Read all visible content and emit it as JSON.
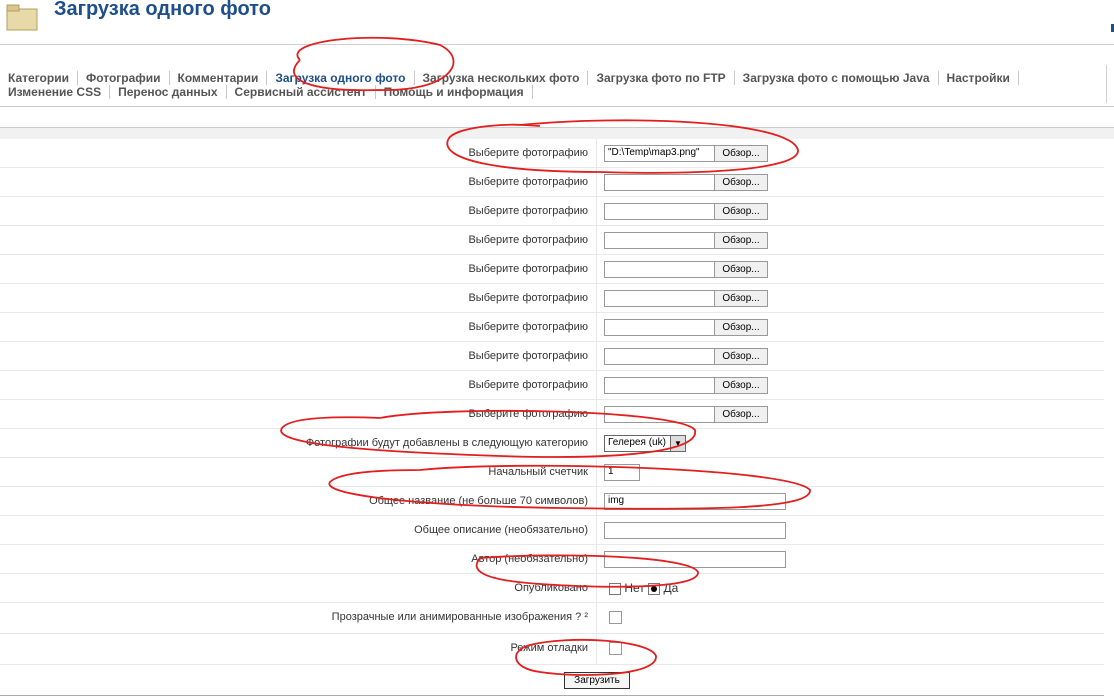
{
  "header": {
    "title": "Загрузка одного фото"
  },
  "tabs_row1": [
    "Категории",
    "Фотографии",
    "Комментарии",
    "Загрузка одного фото",
    "Загрузка нескольких фото",
    "Загрузка фото по FTP",
    "Загрузка фото с помощью Java",
    "Настройки"
  ],
  "tabs_row2": [
    "Изменение CSS",
    "Перенос данных",
    "Сервисный ассистент",
    "Помощь и информация"
  ],
  "active_tab": "Загрузка одного фото",
  "form": {
    "file_label": "Выберите фотографию",
    "file_button": "Обзор...",
    "files": [
      "\"D:\\Temp\\map3.png\"",
      "",
      "",
      "",
      "",
      "",
      "",
      "",
      "",
      ""
    ],
    "category_label": "Фотографии будут добавлены в следующую категорию",
    "category_value": "Гелерея (uk)",
    "counter_label": "Начальный счетчик",
    "counter_value": "1",
    "title_label": "Общее название (не больше 70 символов)",
    "title_value": "img",
    "description_label": "Общее описание (необязательно)",
    "description_value": "",
    "author_label": "Автор (необязательно)",
    "author_value": "",
    "published_label": "Опубликовано",
    "published_no": "Нет",
    "published_yes": "Да",
    "published_selected": "Да",
    "transparent_label": "Прозрачные или анимированные изображения ? ²",
    "transparent_checked": false,
    "debug_label": "Режим отладки",
    "debug_checked": false,
    "submit_label": "Загрузить"
  },
  "colors": {
    "title": "#1e4f8a",
    "annotation": "#e21e1e"
  }
}
